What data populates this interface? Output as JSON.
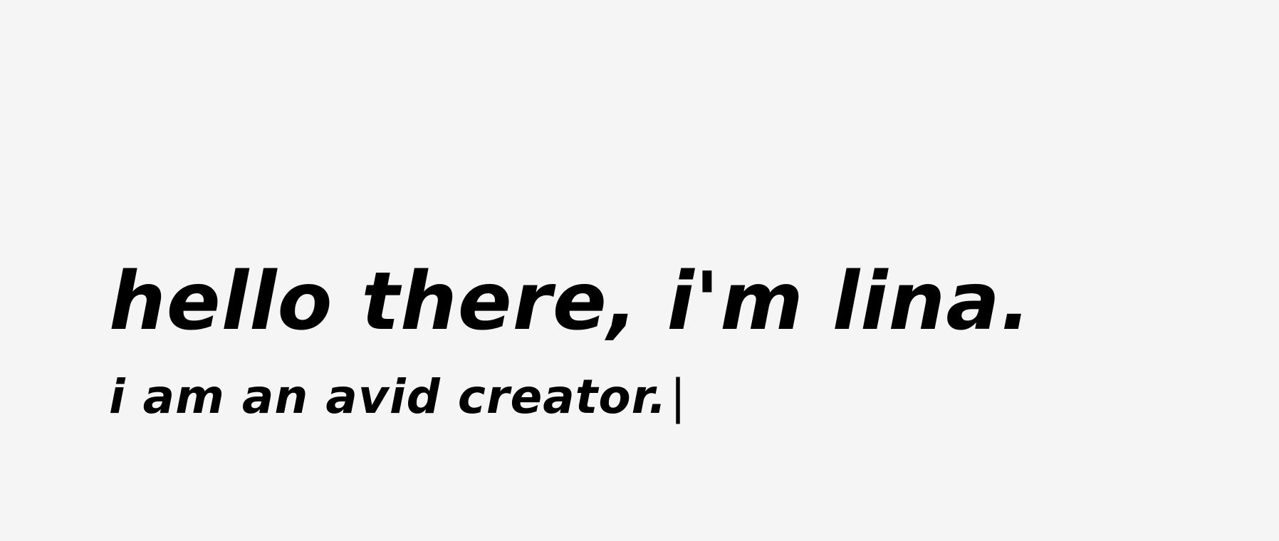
{
  "hero": {
    "headline": "hello there, i'm lina.",
    "subline": "i am an avid creator.",
    "cursor": "|"
  },
  "colors": {
    "background": "#f5f5f5",
    "text": "#000000"
  }
}
